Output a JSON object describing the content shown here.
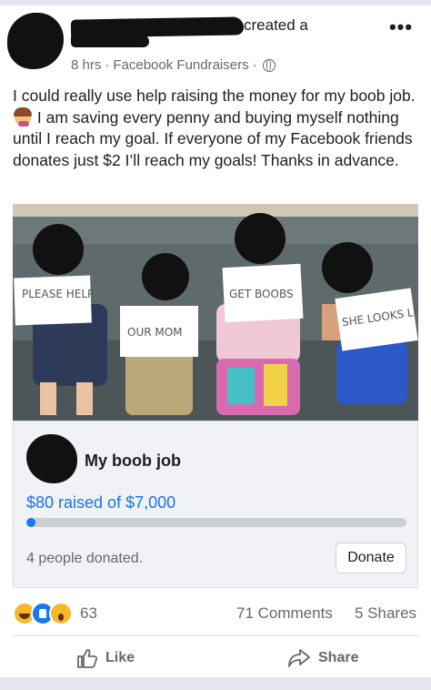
{
  "post": {
    "author_suffix": "created a",
    "time": "8 hrs",
    "source": "Facebook Fundraisers",
    "separator": "·",
    "more_label": "•••",
    "text": "I could really use help raising the money for my boob job.",
    "text_after_emoji": "I am saving every penny and buying myself nothing until I reach my goal. If everyone of my Facebook friends donates just $2 I’ll reach my goals! Thanks in advance."
  },
  "photo": {
    "signs": [
      "PLEASE HELP",
      "OUR MOM",
      "GET BOOBS",
      "SHE LOOKS LIKE OUR DAD!!!"
    ]
  },
  "fundraiser": {
    "title": "My boob job",
    "raised_text": "$80 raised of $7,000",
    "progress": 0.0114,
    "donors": "4 people donated.",
    "donate_label": "Donate"
  },
  "engagement": {
    "reaction_count": "63",
    "comments": "71 Comments",
    "shares": "5 Shares",
    "reaction_icons": [
      "haha-icon",
      "like-icon",
      "wow-icon"
    ]
  },
  "actions": {
    "like_label": "Like",
    "share_label": "Share"
  },
  "colors": {
    "link_blue": "#1b74e4",
    "progress_fill": "#1877f2",
    "progress_track": "#ccd0d5"
  }
}
